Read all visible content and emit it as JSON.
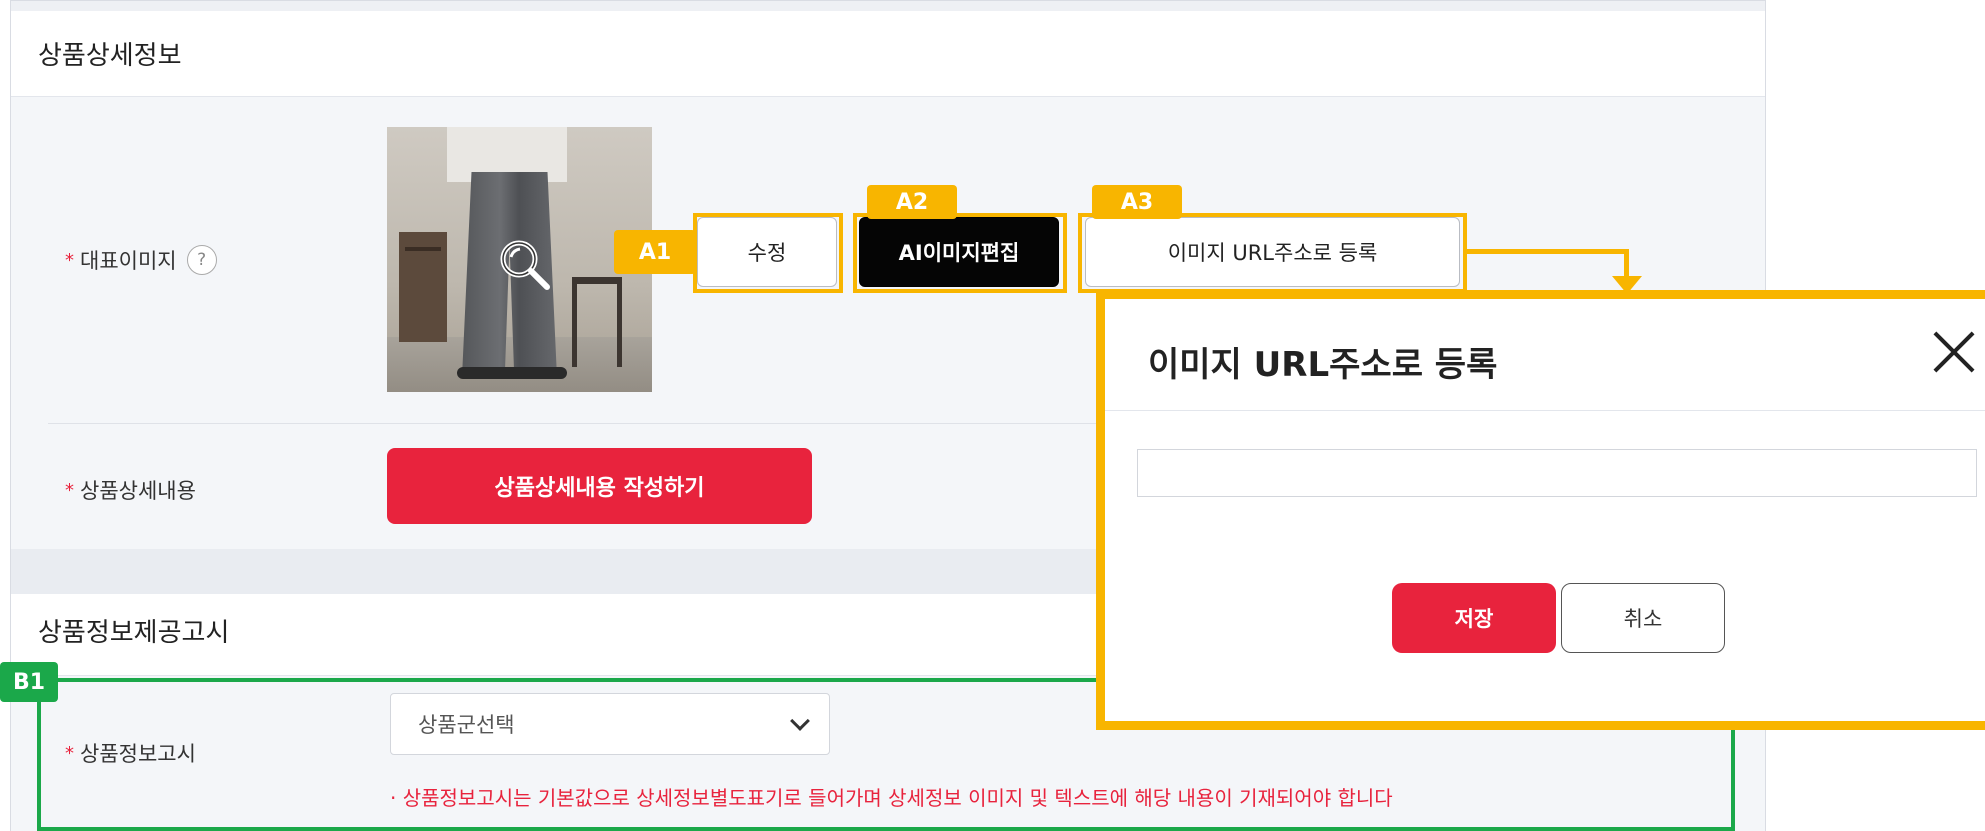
{
  "section_detail": {
    "title": "상품상세정보",
    "rep_image_label": "대표이미지",
    "help_glyph": "?",
    "edit_button": "수정",
    "ai_edit_button": "AI이미지편집",
    "url_register_button": "이미지 URL주소로 등록",
    "detail_content_label": "상품상세내용",
    "write_detail_button": "상품상세내용 작성하기"
  },
  "section_notice": {
    "title": "상품정보제공고시",
    "notice_label": "상품정보고시",
    "category_select": {
      "selected": "상품군선택"
    },
    "notice_text": "· 상품정보고시는 기본값으로 상세정보별도표기로 들어가며 상세정보 이미지 및 텍스트에 해당 내용이 기재되어야 합니다"
  },
  "required_mark": "*",
  "annotations": {
    "a1": "A1",
    "a2": "A2",
    "a3": "A3",
    "b1": "B1"
  },
  "modal": {
    "title": "이미지 URL주소로 등록",
    "input_value": "",
    "save_button": "저장",
    "cancel_button": "취소"
  },
  "colors": {
    "primary_red": "#e8233d",
    "highlight_yellow": "#f8b500",
    "highlight_green": "#1ba84a",
    "ai_button_bg": "#050505"
  },
  "icons": {
    "help": "question-circle-icon",
    "zoom": "magnifier-icon",
    "select_arrow": "chevron-down-icon",
    "modal_close": "close-icon"
  }
}
